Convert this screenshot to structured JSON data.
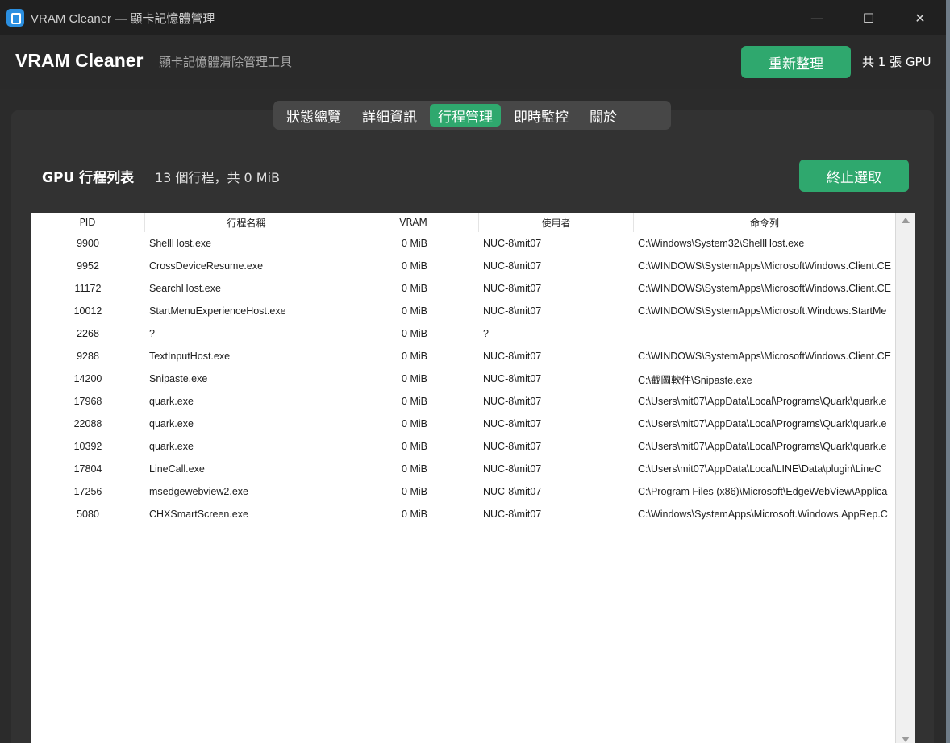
{
  "window": {
    "title": "VRAM Cleaner — 顯卡記憶體管理",
    "controls": {
      "minimize": "—",
      "maximize": "☐",
      "close": "✕"
    }
  },
  "header": {
    "app_name": "VRAM Cleaner",
    "subtitle": "顯卡記憶體清除管理工具",
    "refresh_label": "重新整理",
    "gpu_count": "共 1 張 GPU"
  },
  "tabs": [
    {
      "label": "狀態總覽",
      "active": false
    },
    {
      "label": "詳細資訊",
      "active": false
    },
    {
      "label": "行程管理",
      "active": true
    },
    {
      "label": "即時監控",
      "active": false
    },
    {
      "label": "關於",
      "active": false
    }
  ],
  "process_panel": {
    "title": "GPU 行程列表",
    "summary": "13 個行程，共 0 MiB",
    "kill_label": "終止選取"
  },
  "table": {
    "columns": [
      "PID",
      "行程名稱",
      "VRAM",
      "使用者",
      "命令列"
    ],
    "rows": [
      [
        "9900",
        "ShellHost.exe",
        "0 MiB",
        "NUC-8\\mit07",
        "C:\\Windows\\System32\\ShellHost.exe"
      ],
      [
        "9952",
        "CrossDeviceResume.exe",
        "0 MiB",
        "NUC-8\\mit07",
        "C:\\WINDOWS\\SystemApps\\MicrosoftWindows.Client.CE"
      ],
      [
        "11172",
        "SearchHost.exe",
        "0 MiB",
        "NUC-8\\mit07",
        "C:\\WINDOWS\\SystemApps\\MicrosoftWindows.Client.CE"
      ],
      [
        "10012",
        "StartMenuExperienceHost.exe",
        "0 MiB",
        "NUC-8\\mit07",
        "C:\\WINDOWS\\SystemApps\\Microsoft.Windows.StartMe"
      ],
      [
        "2268",
        "?",
        "0 MiB",
        "?",
        ""
      ],
      [
        "9288",
        "TextInputHost.exe",
        "0 MiB",
        "NUC-8\\mit07",
        "C:\\WINDOWS\\SystemApps\\MicrosoftWindows.Client.CE"
      ],
      [
        "14200",
        "Snipaste.exe",
        "0 MiB",
        "NUC-8\\mit07",
        "C:\\截圖軟件\\Snipaste.exe"
      ],
      [
        "17968",
        "quark.exe",
        "0 MiB",
        "NUC-8\\mit07",
        "C:\\Users\\mit07\\AppData\\Local\\Programs\\Quark\\quark.e"
      ],
      [
        "22088",
        "quark.exe",
        "0 MiB",
        "NUC-8\\mit07",
        "C:\\Users\\mit07\\AppData\\Local\\Programs\\Quark\\quark.e"
      ],
      [
        "10392",
        "quark.exe",
        "0 MiB",
        "NUC-8\\mit07",
        "C:\\Users\\mit07\\AppData\\Local\\Programs\\Quark\\quark.e"
      ],
      [
        "17804",
        "LineCall.exe",
        "0 MiB",
        "NUC-8\\mit07",
        "C:\\Users\\mit07\\AppData\\Local\\LINE\\Data\\plugin\\LineC"
      ],
      [
        "17256",
        "msedgewebview2.exe",
        "0 MiB",
        "NUC-8\\mit07",
        "C:\\Program Files (x86)\\Microsoft\\EdgeWebView\\Applica"
      ],
      [
        "5080",
        "CHXSmartScreen.exe",
        "0 MiB",
        "NUC-8\\mit07",
        "C:\\Windows\\SystemApps\\Microsoft.Windows.AppRep.C"
      ]
    ]
  },
  "colors": {
    "accent": "#2fa86e",
    "background": "#2b2b2b",
    "titlebar": "#202020",
    "panel": "#323232"
  }
}
